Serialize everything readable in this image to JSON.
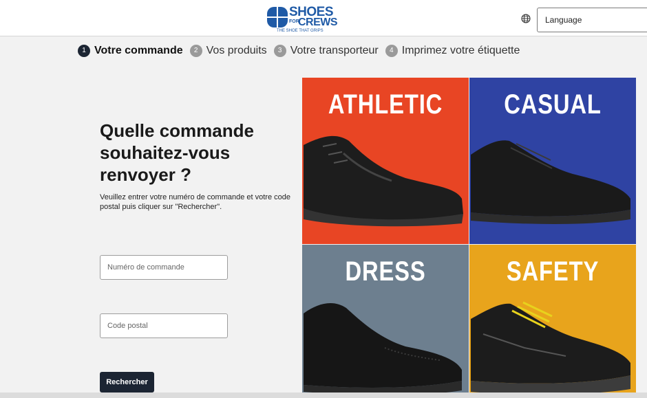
{
  "header": {
    "logo": {
      "line1": "SHOES",
      "for": "FOR",
      "line2": "CREWS",
      "tagline": "THE SHOE THAT GRIPS"
    },
    "globe_icon": "globe-icon",
    "language_select": {
      "value": "Language"
    }
  },
  "steps": [
    {
      "number": "1",
      "label": "Votre commande",
      "active": true
    },
    {
      "number": "2",
      "label": "Vos produits",
      "active": false
    },
    {
      "number": "3",
      "label": "Votre transporteur",
      "active": false
    },
    {
      "number": "4",
      "label": "Imprimez votre étiquette",
      "active": false
    }
  ],
  "form": {
    "title": "Quelle commande souhaitez-vous renvoyer ?",
    "description": "Veuillez entrer votre numéro de commande et votre code postal puis cliquer sur \"Rechercher\".",
    "order_number_placeholder": "Numéro de commande",
    "postal_code_placeholder": "Code postal",
    "search_label": "Rechercher"
  },
  "categories": [
    {
      "label": "ATHLETIC",
      "color": "#e84524"
    },
    {
      "label": "CASUAL",
      "color": "#2f43a3"
    },
    {
      "label": "DRESS",
      "color": "#6d7f8f"
    },
    {
      "label": "SAFETY",
      "color": "#e8a41c"
    }
  ],
  "colors": {
    "accent": "#1c2533",
    "brand": "#1f5aa6"
  }
}
